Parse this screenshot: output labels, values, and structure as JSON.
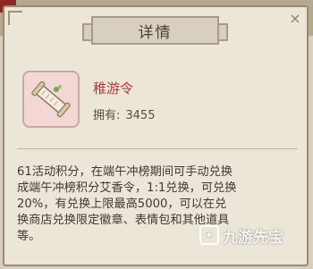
{
  "dialog": {
    "title": "详情",
    "close_icon": "×"
  },
  "item": {
    "icon": "scroll-icon",
    "name": "稚游令",
    "count_label": "拥有:",
    "count_value": "3455",
    "name_color": "#b33a36"
  },
  "description": "61活动积分，在端午冲榜期间可手动兑换\n成端午冲榜积分艾香令，1:1兑换，可兑换\n20%，有兑换上限最高5000，可以在兑\n换商店兑换限定徽章、表情包和其他道具\n等。",
  "watermark": {
    "text": "九游先宝"
  }
}
